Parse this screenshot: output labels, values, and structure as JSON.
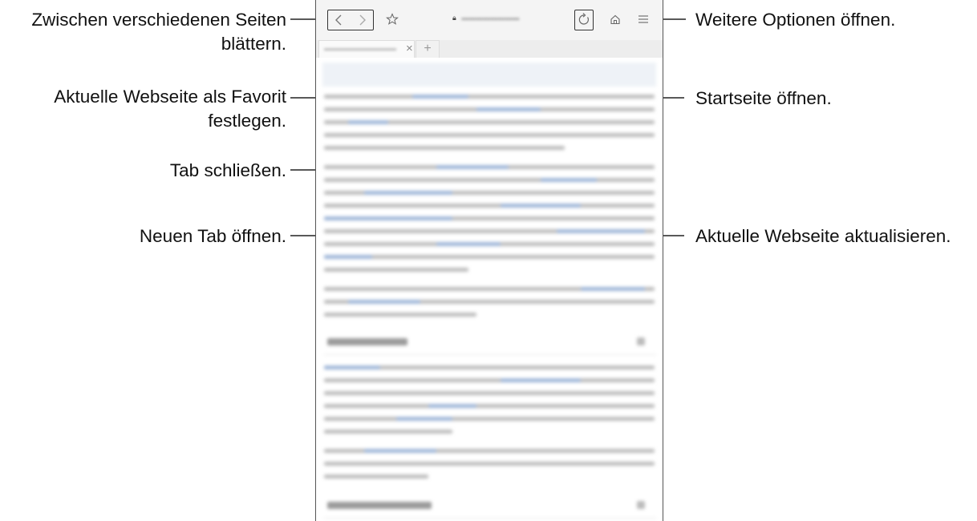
{
  "callouts": {
    "nav_line1": "Zwischen verschiedenen Seiten",
    "nav_line2": "blättern.",
    "fav_line1": "Aktuelle Webseite als Favorit",
    "fav_line2": "festlegen.",
    "close_tab": "Tab schließen.",
    "new_tab": "Neuen Tab öffnen.",
    "more_options": "Weitere Optionen öffnen.",
    "home": "Startseite öffnen.",
    "reload": "Aktuelle Webseite aktualisieren."
  },
  "browser": {
    "back_icon": "chevron-left-icon",
    "forward_icon": "chevron-right-icon",
    "bookmark_icon": "star-outline-icon",
    "lock_icon": "lock-icon",
    "reload_icon": "reload-icon",
    "home_icon": "home-icon",
    "menu_icon": "hamburger-menu-icon",
    "tab_close_glyph": "×",
    "new_tab_glyph": "+"
  }
}
